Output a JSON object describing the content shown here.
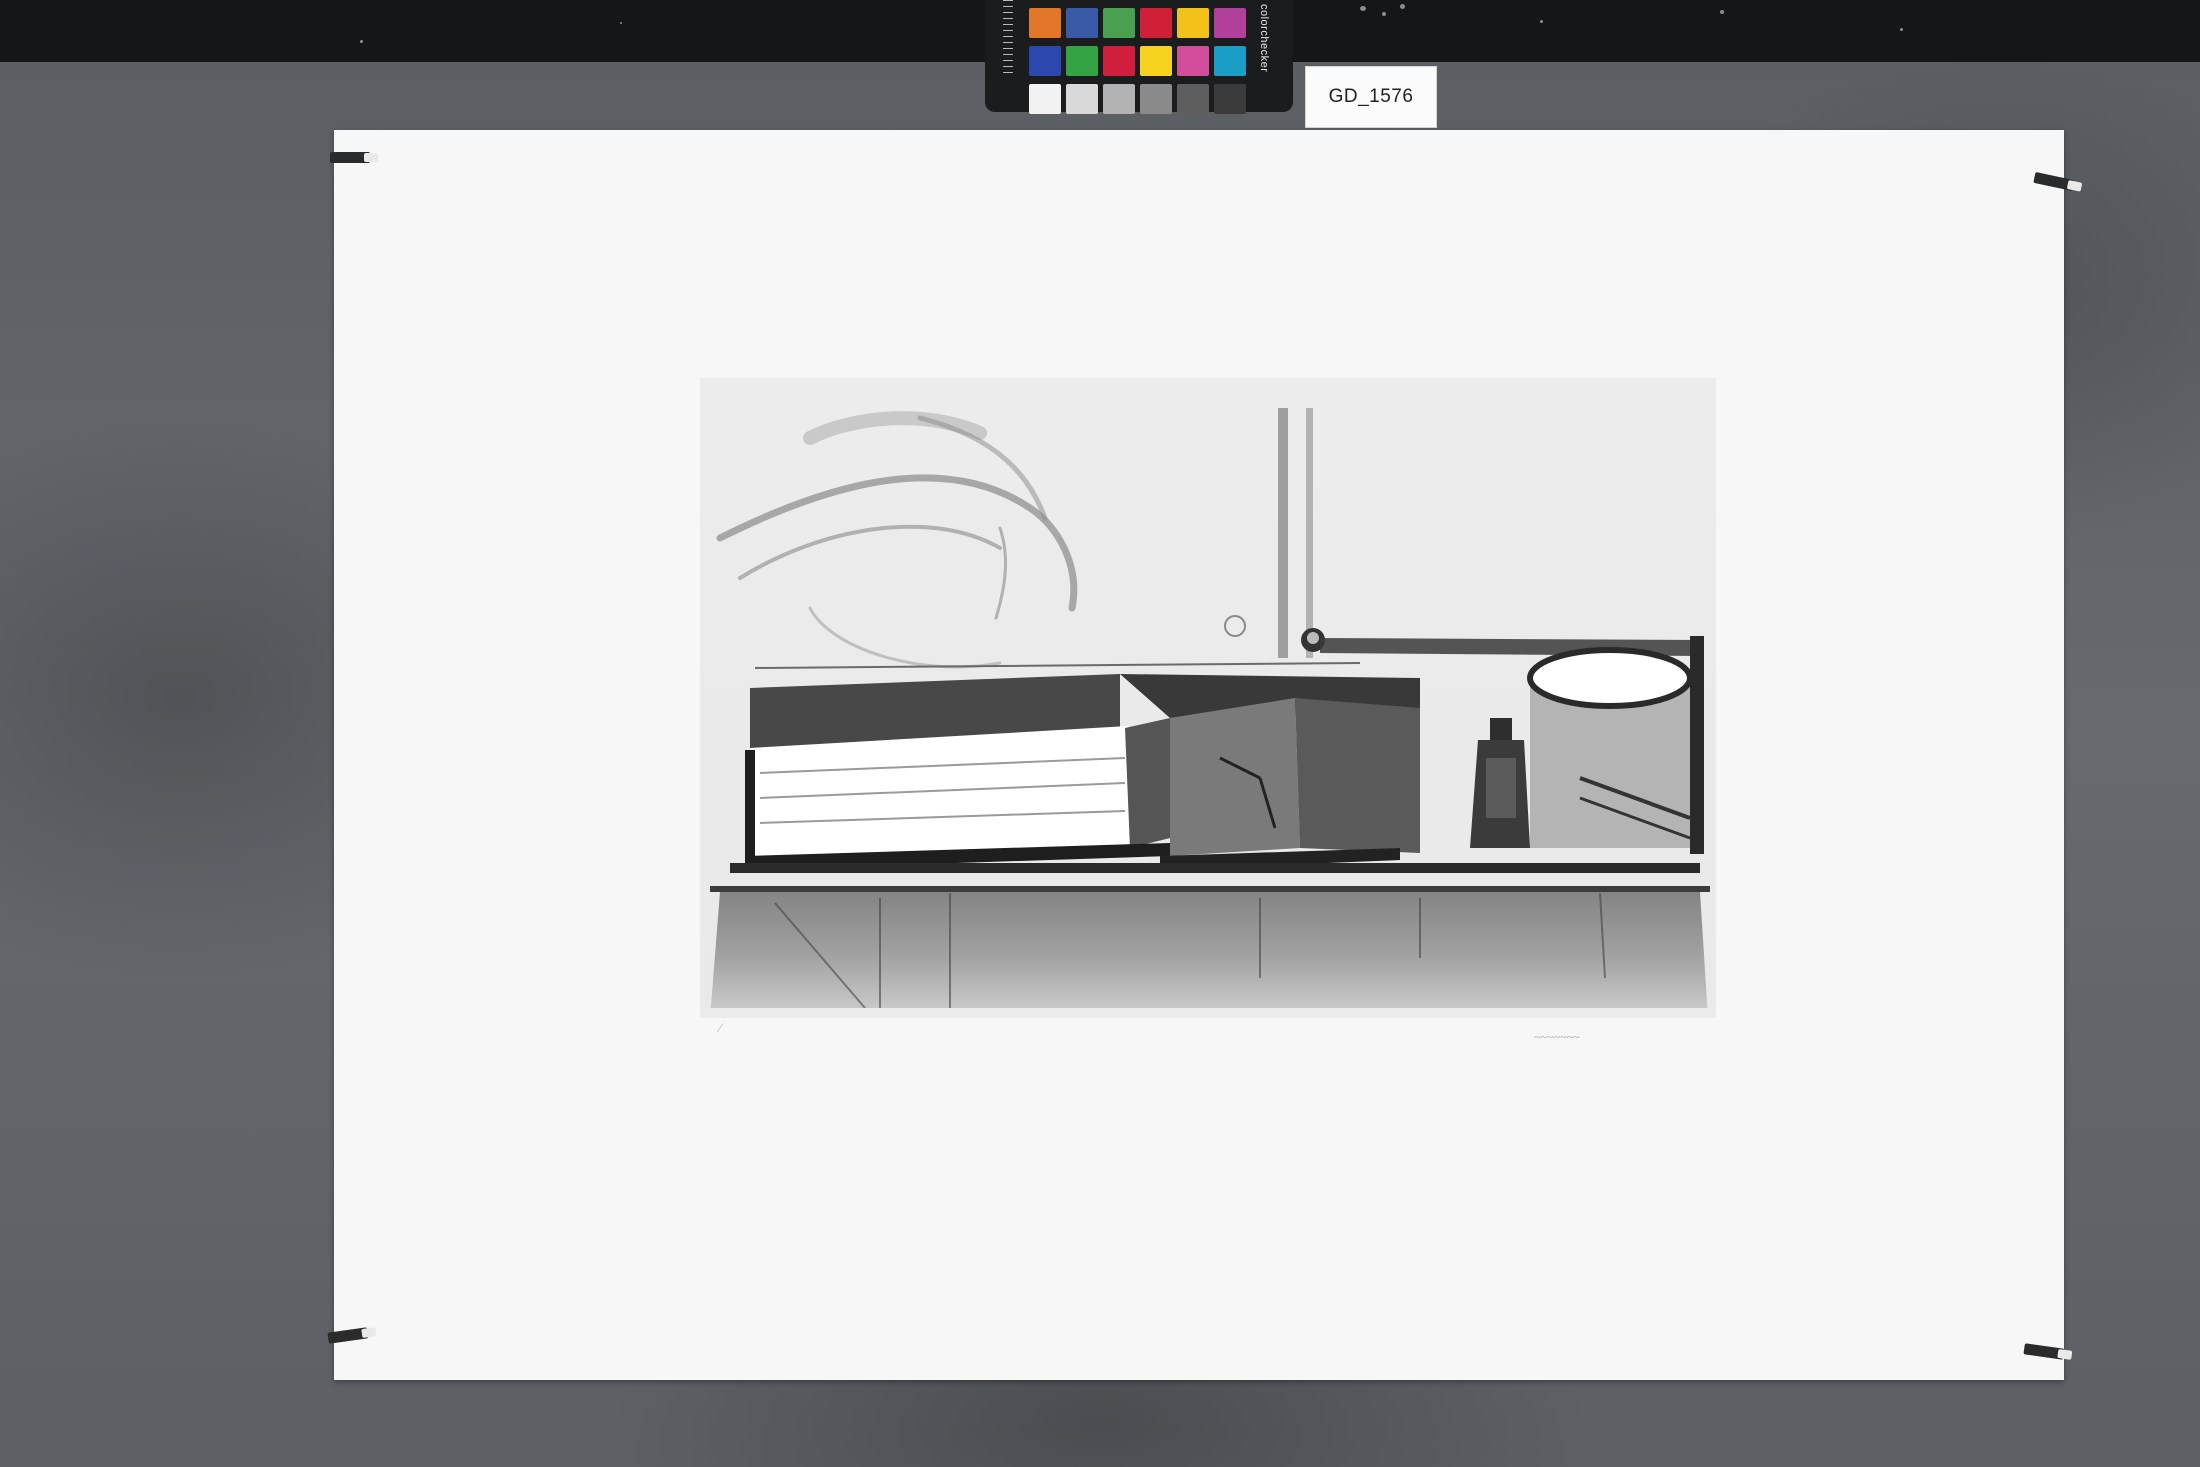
{
  "specimen_tag": {
    "label": "GD_1576"
  },
  "color_checker": {
    "brand": "colorchecker",
    "swatches_row1": [
      "#e2772a",
      "#3a5aa8",
      "#4aa050",
      "#cf2038",
      "#f2c21a",
      "#b0409a"
    ],
    "swatches_row2": [
      "#2c47b0",
      "#33a343",
      "#cf1f3c",
      "#f4d21e",
      "#d24e9a",
      "#1b9ec5"
    ],
    "swatches_row3": [
      "#f2f2f2",
      "#d9d9d9",
      "#b3b3b3",
      "#8a8a8a",
      "#5e5e5e",
      "#3b3b3b"
    ]
  },
  "artwork": {
    "medium_appearance": "monochrome lithograph still life",
    "colors": {
      "paper": "#f7f7f7",
      "ink": "#1e1e1e",
      "background": "#5f6366"
    }
  }
}
